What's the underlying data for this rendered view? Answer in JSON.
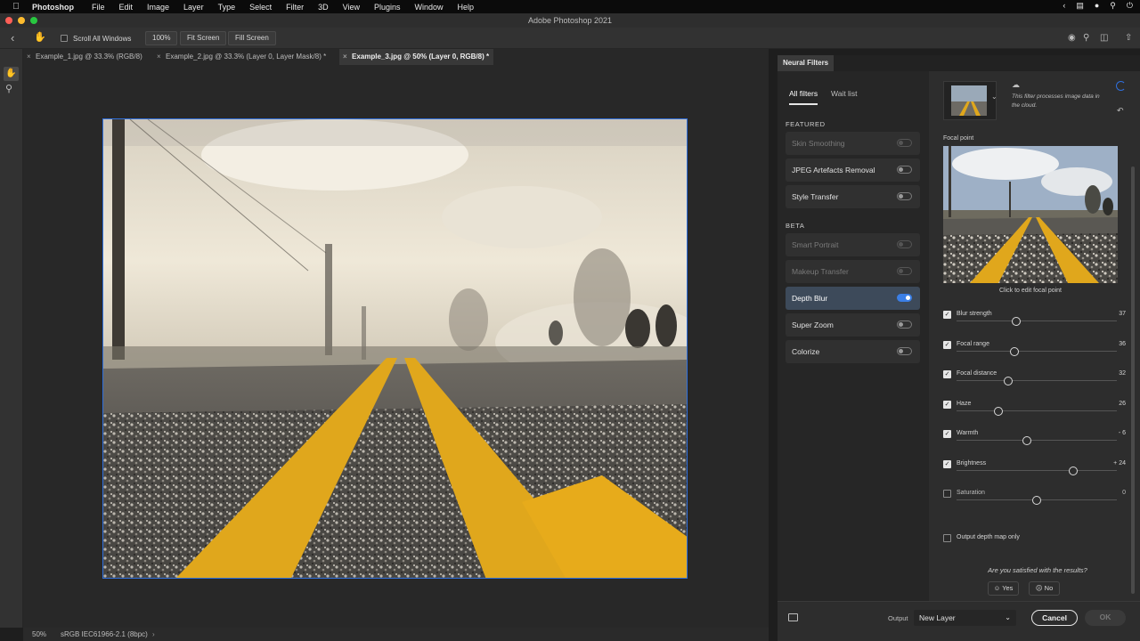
{
  "menubar": {
    "app_name": "Photoshop",
    "items": [
      "File",
      "Edit",
      "Image",
      "Layer",
      "Type",
      "Select",
      "Filter",
      "3D",
      "View",
      "Plugins",
      "Window",
      "Help"
    ]
  },
  "window": {
    "title": "Adobe Photoshop 2021"
  },
  "options_bar": {
    "scroll_all_windows": "Scroll All Windows",
    "zoom_100": "100%",
    "fit_screen": "Fit Screen",
    "fill_screen": "Fill Screen"
  },
  "tabs": [
    {
      "label": "Example_1.jpg @ 33.3% (RGB/8)"
    },
    {
      "label": "Example_2.jpg @ 33.3% (Layer 0, Layer Mask/8) *"
    },
    {
      "label": "Example_3.jpg @ 50% (Layer 0, RGB/8) *"
    }
  ],
  "status_bar": {
    "zoom": "50%",
    "profile": "sRGB IEC61966-2.1 (8bpc)"
  },
  "neural_filters": {
    "panel_title": "Neural Filters",
    "tabs": {
      "all": "All filters",
      "wait": "Wait list"
    },
    "featured_label": "FEATURED",
    "beta_label": "BETA",
    "featured": [
      {
        "name": "Skin Smoothing"
      },
      {
        "name": "JPEG Artefacts Removal"
      },
      {
        "name": "Style Transfer"
      }
    ],
    "beta": [
      {
        "name": "Smart Portrait"
      },
      {
        "name": "Makeup Transfer"
      },
      {
        "name": "Depth Blur"
      },
      {
        "name": "Super Zoom"
      },
      {
        "name": "Colorize"
      }
    ],
    "cloud_note": "This filter processes image data in the cloud.",
    "focal_point_label": "Focal point",
    "focal_hint": "Click to edit focal point",
    "sliders": [
      {
        "label": "Blur strength",
        "value": "37",
        "fraction": 0.37
      },
      {
        "label": "Focal range",
        "value": "36",
        "fraction": 0.36
      },
      {
        "label": "Focal distance",
        "value": "32",
        "fraction": 0.32
      },
      {
        "label": "Haze",
        "value": "26",
        "fraction": 0.26
      },
      {
        "label": "Warmth",
        "value": "- 6",
        "fraction": 0.44
      },
      {
        "label": "Brightness",
        "value": "+ 24",
        "fraction": 0.73
      },
      {
        "label": "Saturation",
        "value": "0",
        "fraction": 0.5
      }
    ],
    "output_depth_map": "Output depth map only",
    "satisfied_question": "Are you satisfied with the results?",
    "yes": "Yes",
    "no": "No",
    "output_label": "Output",
    "output_value": "New Layer",
    "cancel": "Cancel",
    "ok": "OK"
  }
}
